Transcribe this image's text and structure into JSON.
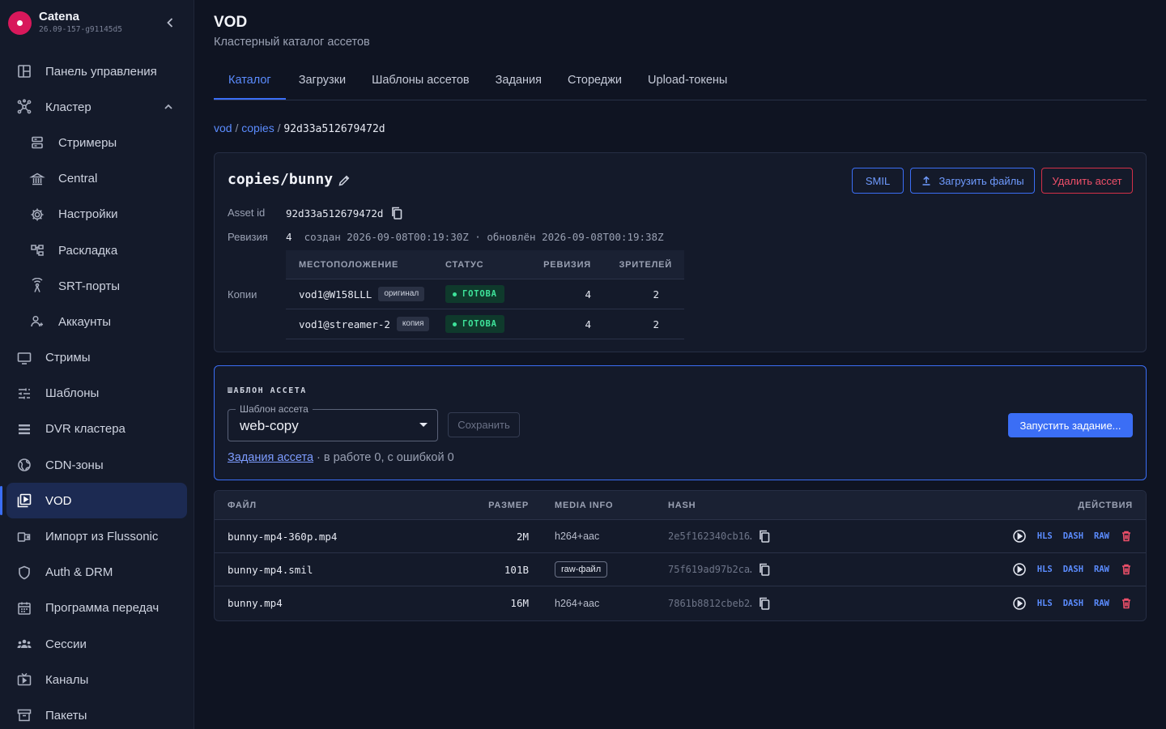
{
  "brand": {
    "name": "Catena",
    "version": "26.09-157-g91145d5"
  },
  "nav": [
    {
      "label": "Панель управления",
      "icon": "dashboard-icon"
    },
    {
      "label": "Кластер",
      "icon": "cluster-icon"
    },
    {
      "label": "Стримеры",
      "icon": "server-icon",
      "sub": true
    },
    {
      "label": "Central",
      "icon": "bank-icon",
      "sub": true
    },
    {
      "label": "Настройки",
      "icon": "gear-icon",
      "sub": true
    },
    {
      "label": "Раскладка",
      "icon": "layout-icon",
      "sub": true
    },
    {
      "label": "SRT-порты",
      "icon": "antenna-icon",
      "sub": true
    },
    {
      "label": "Аккаунты",
      "icon": "accounts-icon",
      "sub": true
    },
    {
      "label": "Стримы",
      "icon": "monitor-icon"
    },
    {
      "label": "Шаблоны",
      "icon": "sliders-icon"
    },
    {
      "label": "DVR кластера",
      "icon": "list-icon"
    },
    {
      "label": "CDN-зоны",
      "icon": "globe-icon"
    },
    {
      "label": "VOD",
      "icon": "video-library-icon",
      "active": true
    },
    {
      "label": "Импорт из Flussonic",
      "icon": "import-icon"
    },
    {
      "label": "Auth & DRM",
      "icon": "shield-icon"
    },
    {
      "label": "Программа передач",
      "icon": "calendar-icon"
    },
    {
      "label": "Сессии",
      "icon": "people-icon"
    },
    {
      "label": "Каналы",
      "icon": "tv-icon"
    },
    {
      "label": "Пакеты",
      "icon": "archive-icon"
    }
  ],
  "page": {
    "title": "VOD",
    "subtitle": "Кластерный каталог ассетов"
  },
  "tabs": [
    "Каталог",
    "Загрузки",
    "Шаблоны ассетов",
    "Задания",
    "Стореджи",
    "Upload-токены"
  ],
  "breadcrumb": {
    "root": "vod",
    "sep": "/",
    "folder": "copies",
    "current": "92d33a512679472d"
  },
  "asset": {
    "title": "copies/bunny",
    "smil_label": "SMIL",
    "upload_label": "Загрузить файлы",
    "delete_label": "Удалить ассет",
    "id_label": "Asset id",
    "id": "92d33a512679472d",
    "revision_label": "Ревизия",
    "revision": "4",
    "revision_meta": "создан 2026-09-08T00:19:30Z · обновлён 2026-09-08T00:19:38Z",
    "copies_label": "Копии",
    "copies_headers": [
      "МЕСТОПОЛОЖЕНИЕ",
      "СТАТУС",
      "РЕВИЗИЯ",
      "ЗРИТЕЛЕЙ"
    ],
    "copies": [
      {
        "location": "vod1@W158LLL",
        "tag": "оригинал",
        "status": "ГОТОВА",
        "revision": "4",
        "viewers": "2"
      },
      {
        "location": "vod1@streamer-2",
        "tag": "копия",
        "status": "ГОТОВА",
        "revision": "4",
        "viewers": "2"
      }
    ]
  },
  "template": {
    "header": "ШАБЛОН АССЕТА",
    "select_legend": "Шаблон ассета",
    "select_value": "web-copy",
    "save_label": "Сохранить",
    "run_label": "Запустить задание...",
    "jobs_link": "Задания ассета",
    "jobs_status": " · в работе 0, с ошибкой 0"
  },
  "files": {
    "headers": [
      "ФАЙЛ",
      "РАЗМЕР",
      "MEDIA INFO",
      "HASH",
      "ДЕЙСТВИЯ"
    ],
    "rows": [
      {
        "name": "bunny-mp4-360p.mp4",
        "size": "2M",
        "media": "h264+aac",
        "raw": false,
        "hash": "2e5f162340cb16…"
      },
      {
        "name": "bunny-mp4.smil",
        "size": "101B",
        "media": "raw-файл",
        "raw": true,
        "hash": "75f619ad97b2ca…"
      },
      {
        "name": "bunny.mp4",
        "size": "16M",
        "media": "h264+aac",
        "raw": false,
        "hash": "7861b8812cbeb2…"
      }
    ],
    "actions": [
      "HLS",
      "DASH",
      "RAW"
    ]
  }
}
